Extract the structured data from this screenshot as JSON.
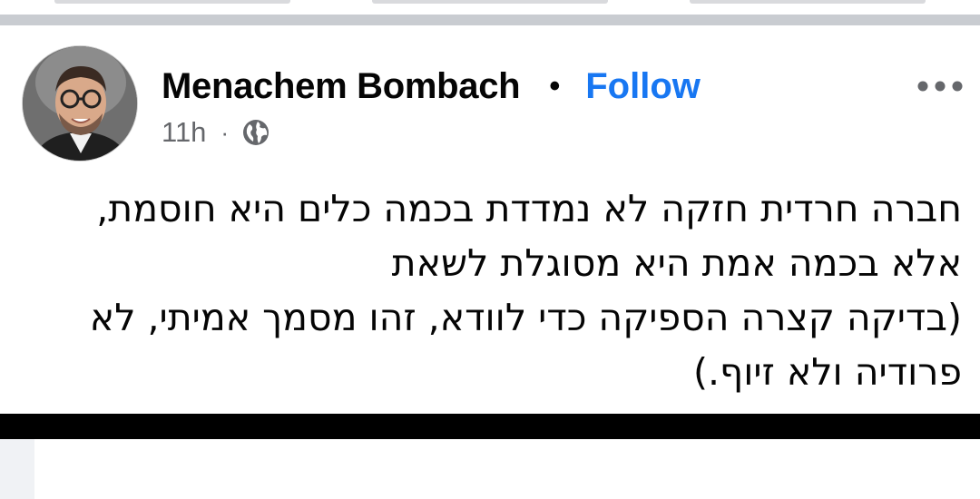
{
  "post": {
    "author": "Menachem Bombach",
    "separator": "•",
    "follow_label": "Follow",
    "time": "11h",
    "meta_separator": "·",
    "privacy_icon": "globe-icon",
    "more_icon": "more-options-icon",
    "text": "חברה חרדית חזקה לא נמדדת בכמה כלים היא חוסמת,\nאלא בכמה אמת היא מסוגלת לשאת\n(בדיקה קצרה הספיקה כדי לוודא, זהו מסמך אמיתי, לא\nפרודיה ולא זיוף.)"
  },
  "colors": {
    "follow": "#1877f2",
    "meta": "#65676b",
    "divider": "#c9ccd1"
  }
}
